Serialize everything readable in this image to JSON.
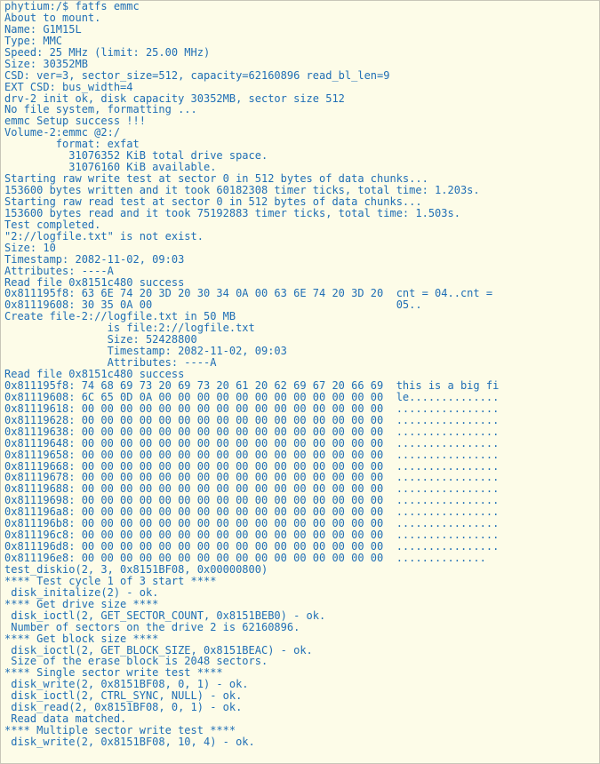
{
  "terminal": {
    "lines": [
      "phytium:/$ fatfs emmc",
      "About to mount.",
      "Name: G1M15L",
      "Type: MMC",
      "Speed: 25 MHz (limit: 25.00 MHz)",
      "Size: 30352MB",
      "CSD: ver=3, sector_size=512, capacity=62160896 read_bl_len=9",
      "EXT CSD: bus_width=4",
      "drv-2 init ok, disk capacity 30352MB, sector size 512",
      "No file system, formatting ...",
      "emmc Setup success !!!",
      "Volume-2:emmc @2:/",
      "        format: exfat",
      "          31076352 KiB total drive space.",
      "          31076160 KiB available.",
      "Starting raw write test at sector 0 in 512 bytes of data chunks...",
      "153600 bytes written and it took 60182308 timer ticks, total time: 1.203s.",
      "Starting raw read test at sector 0 in 512 bytes of data chunks...",
      "153600 bytes read and it took 75192883 timer ticks, total time: 1.503s.",
      "Test completed.",
      "\"2://logfile.txt\" is not exist.",
      "Size: 10",
      "Timestamp: 2082-11-02, 09:03",
      "Attributes: ----A",
      "Read file 0x8151c480 success",
      "0x811195f8: 63 6E 74 20 3D 20 30 34 0A 00 63 6E 74 20 3D 20  cnt = 04..cnt =",
      "0x81119608: 30 35 0A 00                                      05..",
      "Create file-2://logfile.txt in 50 MB",
      "                is file:2://logfile.txt",
      "                Size: 52428800",
      "                Timestamp: 2082-11-02, 09:03",
      "                Attributes: ----A",
      "Read file 0x8151c480 success",
      "0x811195f8: 74 68 69 73 20 69 73 20 61 20 62 69 67 20 66 69  this is a big fi",
      "0x81119608: 6C 65 0D 0A 00 00 00 00 00 00 00 00 00 00 00 00  le..............",
      "0x81119618: 00 00 00 00 00 00 00 00 00 00 00 00 00 00 00 00  ................",
      "0x81119628: 00 00 00 00 00 00 00 00 00 00 00 00 00 00 00 00  ................",
      "0x81119638: 00 00 00 00 00 00 00 00 00 00 00 00 00 00 00 00  ................",
      "0x81119648: 00 00 00 00 00 00 00 00 00 00 00 00 00 00 00 00  ................",
      "0x81119658: 00 00 00 00 00 00 00 00 00 00 00 00 00 00 00 00  ................",
      "0x81119668: 00 00 00 00 00 00 00 00 00 00 00 00 00 00 00 00  ................",
      "0x81119678: 00 00 00 00 00 00 00 00 00 00 00 00 00 00 00 00  ................",
      "0x81119688: 00 00 00 00 00 00 00 00 00 00 00 00 00 00 00 00  ................",
      "0x81119698: 00 00 00 00 00 00 00 00 00 00 00 00 00 00 00 00  ................",
      "0x811196a8: 00 00 00 00 00 00 00 00 00 00 00 00 00 00 00 00  ................",
      "0x811196b8: 00 00 00 00 00 00 00 00 00 00 00 00 00 00 00 00  ................",
      "0x811196c8: 00 00 00 00 00 00 00 00 00 00 00 00 00 00 00 00  ................",
      "0x811196d8: 00 00 00 00 00 00 00 00 00 00 00 00 00 00 00 00  ................",
      "0x811196e8: 00 00 00 00 00 00 00 00 00 00 00 00 00 00 00 00  ..............",
      "test_diskio(2, 3, 0x8151BF08, 0x00000800)",
      "**** Test cycle 1 of 3 start ****",
      " disk_initalize(2) - ok.",
      "**** Get drive size ****",
      " disk_ioctl(2, GET_SECTOR_COUNT, 0x8151BEB0) - ok.",
      " Number of sectors on the drive 2 is 62160896.",
      "**** Get block size ****",
      " disk_ioctl(2, GET_BLOCK_SIZE, 0x8151BEAC) - ok.",
      " Size of the erase block is 2048 sectors.",
      "**** Single sector write test ****",
      " disk_write(2, 0x8151BF08, 0, 1) - ok.",
      " disk_ioctl(2, CTRL_SYNC, NULL) - ok.",
      " disk_read(2, 0x8151BF08, 0, 1) - ok.",
      " Read data matched.",
      "**** Multiple sector write test ****",
      " disk_write(2, 0x8151BF08, 10, 4) - ok."
    ]
  }
}
